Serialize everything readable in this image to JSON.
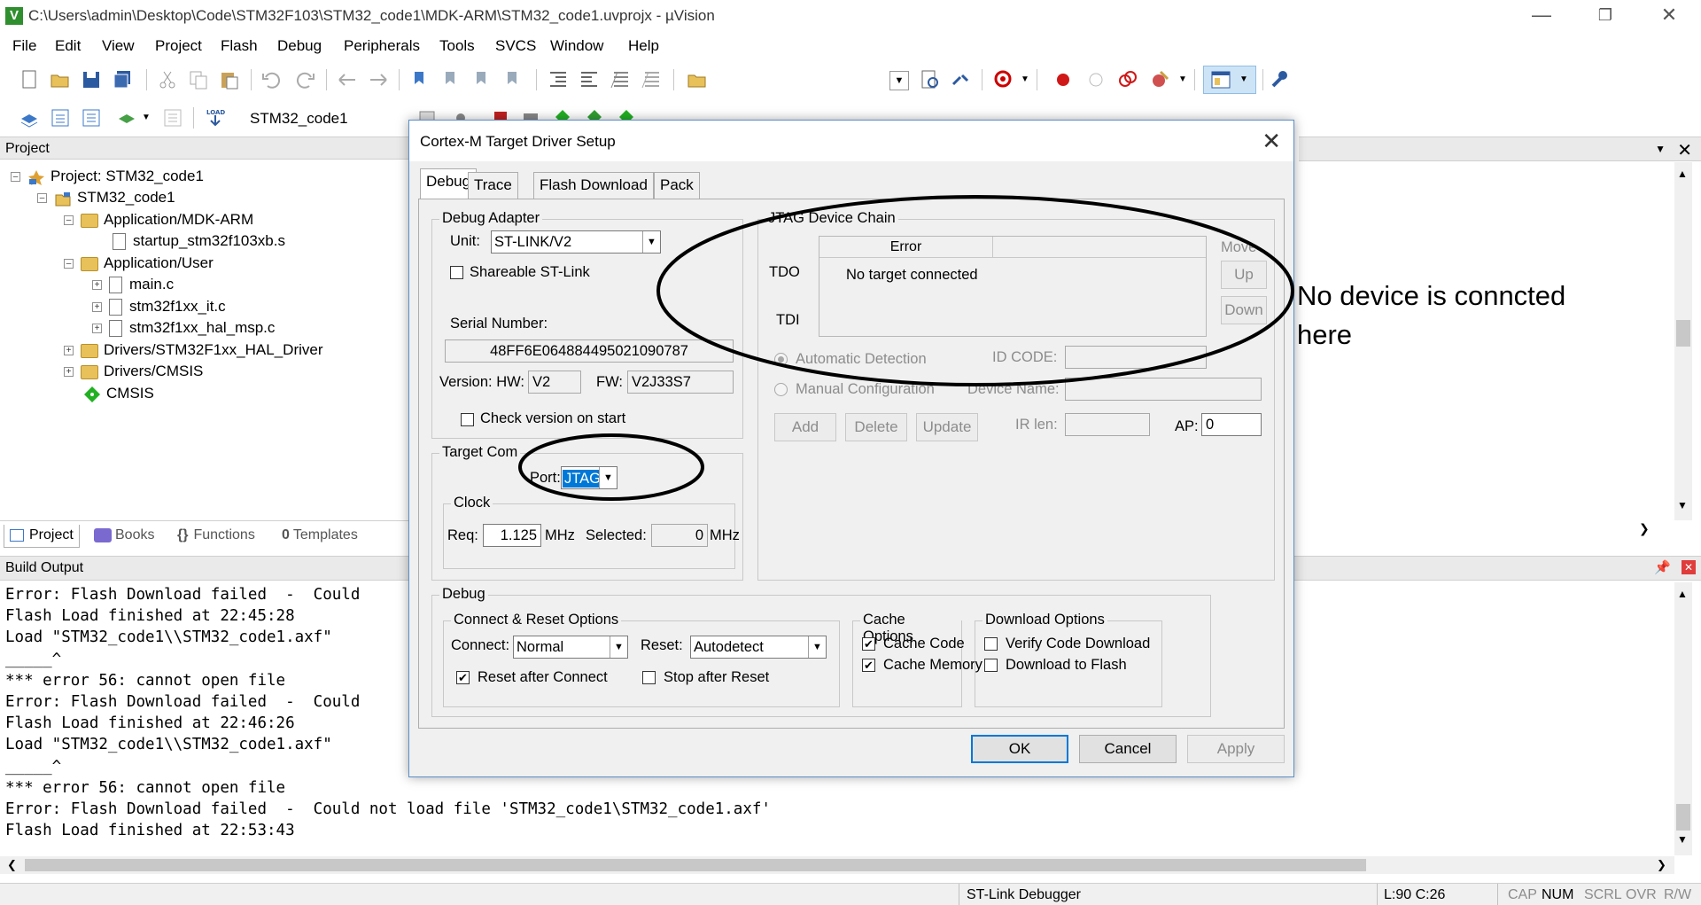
{
  "window": {
    "title": "C:\\Users\\admin\\Desktop\\Code\\STM32F103\\STM32_code1\\MDK-ARM\\STM32_code1.uvprojx - µVision",
    "controls": [
      "minimize",
      "restore",
      "close"
    ]
  },
  "menu": [
    "File",
    "Edit",
    "View",
    "Project",
    "Flash",
    "Debug",
    "Peripherals",
    "Tools",
    "SVCS",
    "Window",
    "Help"
  ],
  "toolbar2": {
    "target_name": "STM32_code1"
  },
  "project_panel": {
    "header": "Project",
    "tree": [
      {
        "label": "Project: STM32_code1",
        "type": "project"
      },
      {
        "label": "STM32_code1",
        "type": "target"
      },
      {
        "label": "Application/MDK-ARM",
        "type": "folder"
      },
      {
        "label": "startup_stm32f103xb.s",
        "type": "file"
      },
      {
        "label": "Application/User",
        "type": "folder"
      },
      {
        "label": "main.c",
        "type": "file"
      },
      {
        "label": "stm32f1xx_it.c",
        "type": "file"
      },
      {
        "label": "stm32f1xx_hal_msp.c",
        "type": "file"
      },
      {
        "label": "Drivers/STM32F1xx_HAL_Driver",
        "type": "folder"
      },
      {
        "label": "Drivers/CMSIS",
        "type": "folder"
      },
      {
        "label": "CMSIS",
        "type": "component"
      }
    ],
    "tabs": [
      "Project",
      "Books",
      "Functions",
      "Templates"
    ]
  },
  "build_output": {
    "header": "Build Output",
    "lines": [
      "Error: Flash Download failed  -  Could",
      "Flash Load finished at 22:45:28",
      "Load \"STM32_code1\\\\STM32_code1.axf\"",
      "_____^",
      "*** error 56: cannot open file",
      "Error: Flash Download failed  -  Could",
      "Flash Load finished at 22:46:26",
      "Load \"STM32_code1\\\\STM32_code1.axf\"",
      "_____^",
      "*** error 56: cannot open file",
      "Error: Flash Download failed  -  Could not load file 'STM32_code1\\STM32_code1.axf'",
      "Flash Load finished at 22:53:43"
    ]
  },
  "statusbar": {
    "debugger": "ST-Link Debugger",
    "position": "L:90 C:26",
    "indicators": [
      "CAP",
      "NUM",
      "SCRL",
      "OVR",
      "R/W"
    ]
  },
  "dialog": {
    "title": "Cortex-M Target Driver Setup",
    "tabs": [
      "Debug",
      "Trace",
      "Flash Download",
      "Pack"
    ],
    "debug_adapter": {
      "label": "Debug Adapter",
      "unit_label": "Unit:",
      "unit_value": "ST-LINK/V2",
      "shareable_label": "Shareable ST-Link",
      "serial_label": "Serial Number:",
      "serial_value": "48FF6E064884495021090787",
      "version_label": "Version: HW:",
      "hw_value": "V2",
      "fw_label": "FW:",
      "fw_value": "V2J33S7",
      "check_version_label": "Check version on start"
    },
    "target_com": {
      "label": "Target Com",
      "port_label": "Port:",
      "port_value": "JTAG",
      "clock_label": "Clock",
      "req_label": "Req:",
      "req_value": "1.125",
      "mhz1": "MHz",
      "selected_label": "Selected:",
      "selected_value": "0",
      "mhz2": "MHz"
    },
    "jtag_chain": {
      "label": "JTAG Device Chain",
      "column_header": "Error",
      "status": "No target connected",
      "tdo": "TDO",
      "tdi": "TDI",
      "move_label": "Move",
      "up_label": "Up",
      "down_label": "Down",
      "auto_detect": "Automatic Detection",
      "manual_config": "Manual Configuration",
      "id_code_label": "ID CODE:",
      "device_name_label": "Device Name:",
      "add": "Add",
      "delete": "Delete",
      "update": "Update",
      "ir_len_label": "IR len:",
      "ap_label": "AP:",
      "ap_value": "0"
    },
    "debug_group": {
      "label": "Debug",
      "connect_reset": {
        "label": "Connect & Reset Options",
        "connect_label": "Connect:",
        "connect_value": "Normal",
        "reset_label": "Reset:",
        "reset_value": "Autodetect",
        "reset_after_connect": "Reset after Connect",
        "reset_after_connect_checked": true,
        "stop_after_reset": "Stop after Reset",
        "stop_after_reset_checked": false
      },
      "cache": {
        "label": "Cache Options",
        "cache_code": "Cache Code",
        "cache_code_checked": true,
        "cache_memory": "Cache Memory",
        "cache_memory_checked": true
      },
      "download": {
        "label": "Download Options",
        "verify": "Verify Code Download",
        "verify_checked": false,
        "download_flash": "Download to Flash",
        "download_flash_checked": false
      }
    },
    "buttons": {
      "ok": "OK",
      "cancel": "Cancel",
      "apply": "Apply"
    }
  },
  "annotation": {
    "line1": "No device is conncted",
    "line2": "here"
  }
}
